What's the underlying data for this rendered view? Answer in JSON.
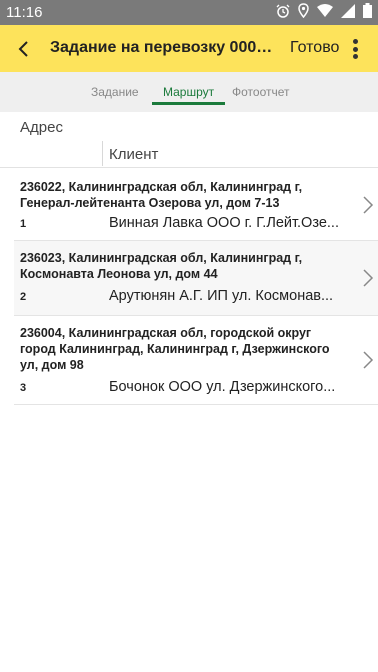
{
  "status_bar": {
    "time": "11:16",
    "icons": [
      "alarm-icon",
      "location-icon",
      "wifi-icon",
      "signal-icon",
      "battery-icon"
    ]
  },
  "app_bar": {
    "title": "Задание на перевозку 00000...",
    "done_label": "Готово",
    "background": "#fde35b"
  },
  "tabs": [
    {
      "label": "Задание",
      "active": false
    },
    {
      "label": "Маршрут",
      "active": true
    },
    {
      "label": "Фотоотчет",
      "active": false
    }
  ],
  "accent_color": "#1b7a3b",
  "columns": {
    "address": "Адрес",
    "client": "Клиент"
  },
  "rows": [
    {
      "address": "236022, Калининградская обл, Калининград г, Генерал-лейтенанта Озерова ул, дом 7-13",
      "number": "1",
      "client": "Винная Лавка ООО г. Г.Лейт.Озе..."
    },
    {
      "address": "236023, Калининградская обл, Калининград г, Космонавта Леонова ул, дом 44",
      "number": "2",
      "client": "Арутюнян А.Г. ИП ул. Космонав..."
    },
    {
      "address": "236004, Калининградская обл, городской округ город Калининград, Калининград г, Дзержинского ул, дом 98",
      "number": "3",
      "client": "Бочонок ООО ул. Дзержинского..."
    }
  ]
}
